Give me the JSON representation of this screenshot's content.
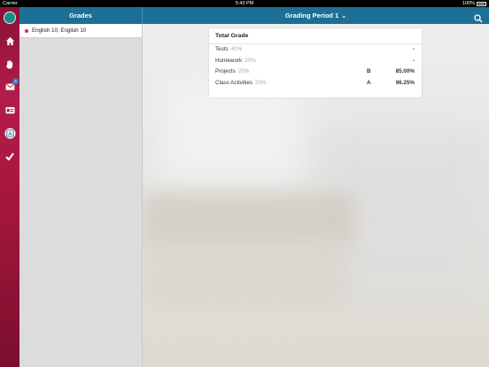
{
  "status_bar": {
    "carrier": "Carrier",
    "time": "5:43 PM",
    "battery": "100%"
  },
  "header": {
    "left_title": "Grades",
    "period": "Grading Period 1"
  },
  "courses": [
    {
      "label": "English 10; English 10"
    }
  ],
  "rail": {
    "mail_badge": "4"
  },
  "grade_card": {
    "title": "Total Grade",
    "rows": [
      {
        "category": "Tests",
        "weight": "40%",
        "letter": "",
        "percent": "-"
      },
      {
        "category": "Homework",
        "weight": "20%",
        "letter": "",
        "percent": "-"
      },
      {
        "category": "Projects",
        "weight": "20%",
        "letter": "B",
        "percent": "85.00%"
      },
      {
        "category": "Class Activities",
        "weight": "20%",
        "letter": "A",
        "percent": "96.25%"
      }
    ]
  }
}
